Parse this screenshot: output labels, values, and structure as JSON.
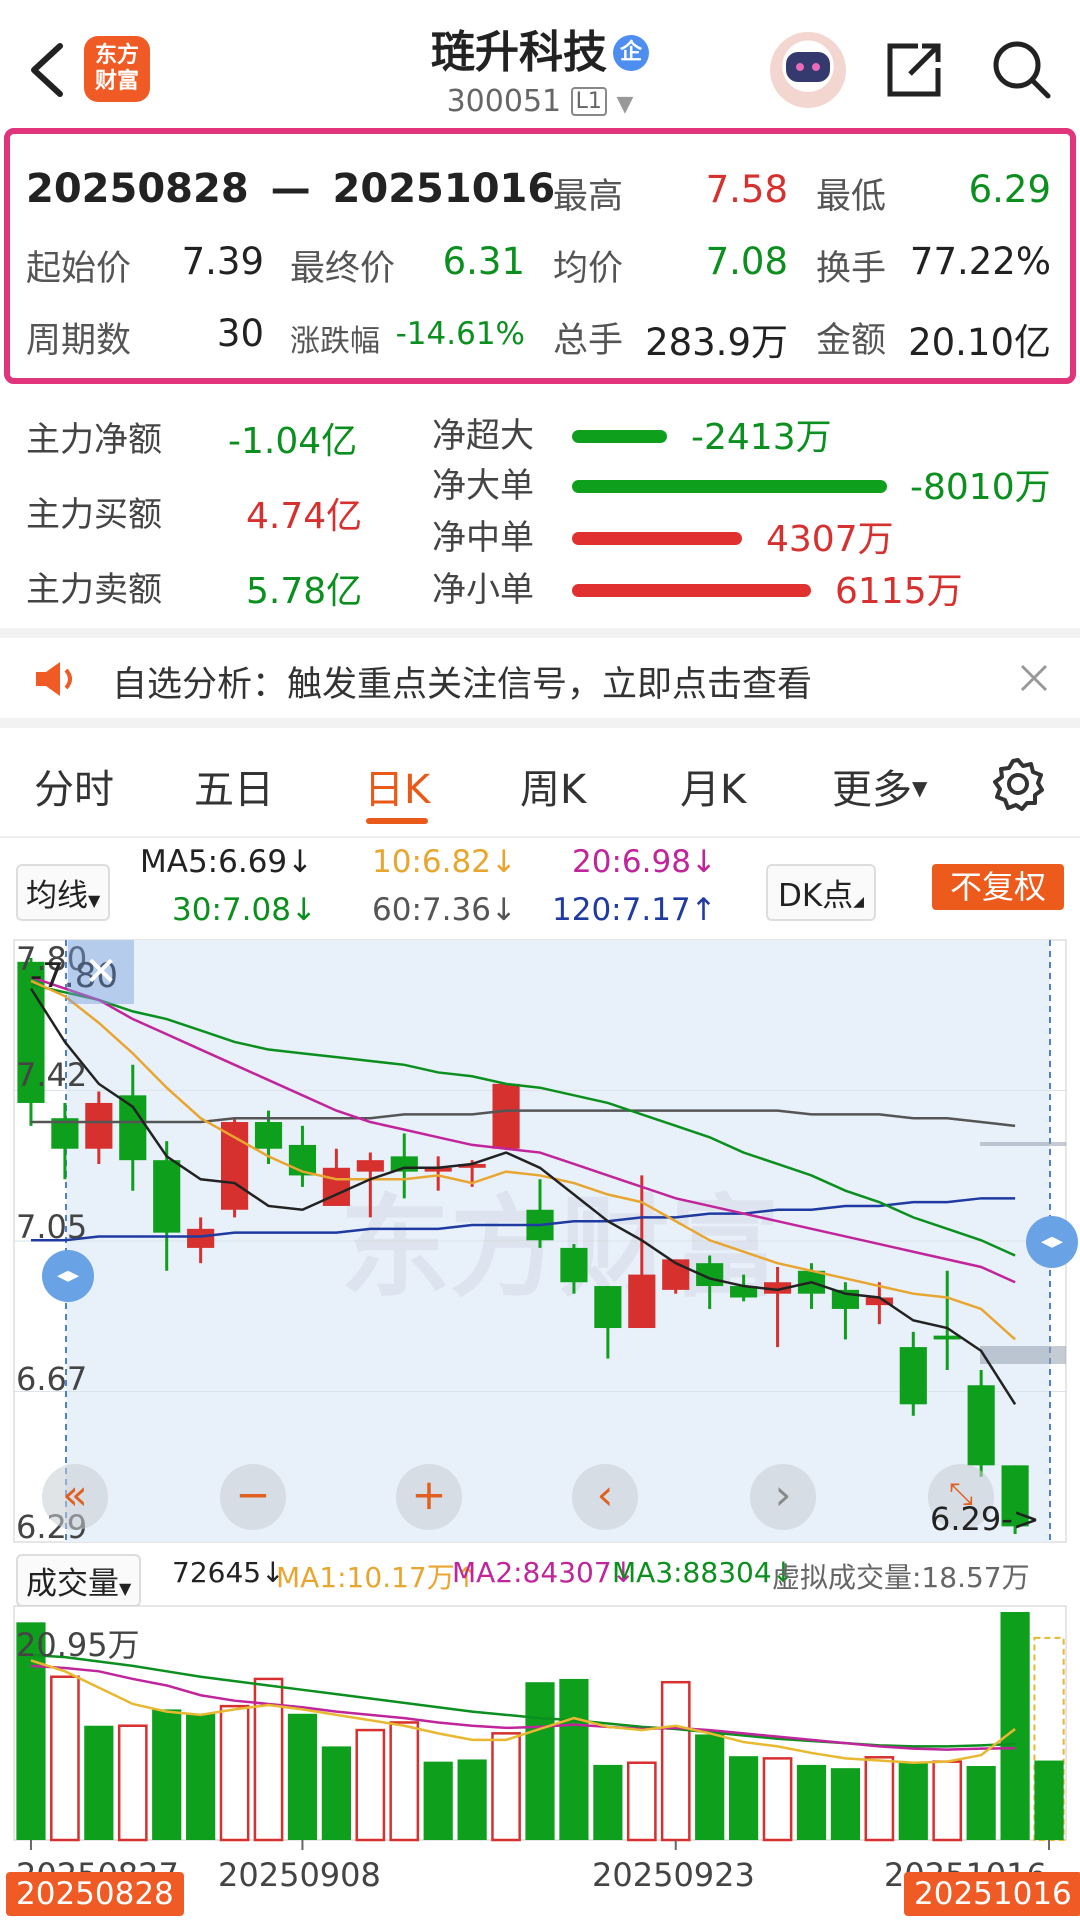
{
  "header": {
    "title": "琏升科技",
    "badge": "企",
    "code": "300051",
    "level": "L1",
    "logo_line1": "东方",
    "logo_line2": "财富"
  },
  "summary": {
    "range_start": "20250828",
    "range_sep": "—",
    "range_end": "20251016",
    "high_label": "最高",
    "high": "7.58",
    "low_label": "最低",
    "low": "6.29",
    "open_label": "起始价",
    "open": "7.39",
    "close_label": "最终价",
    "close": "6.31",
    "avg_label": "均价",
    "avg": "7.08",
    "turnover_label": "换手",
    "turnover": "77.22%",
    "periods_label": "周期数",
    "periods": "30",
    "change_label": "涨跌幅",
    "change": "-14.61%",
    "volume_label": "总手",
    "volume": "283.9万",
    "amount_label": "金额",
    "amount": "20.10亿"
  },
  "flow": {
    "net_label": "主力净额",
    "net": "-1.04亿",
    "buy_label": "主力买额",
    "buy": "4.74亿",
    "sell_label": "主力卖额",
    "sell": "5.78亿",
    "rows": [
      {
        "label": "净超大",
        "value": "-2413万",
        "color": "#0e9f1d",
        "fraction": 0.3
      },
      {
        "label": "净大单",
        "value": "-8010万",
        "color": "#0e9f1d",
        "fraction": 1.0
      },
      {
        "label": "净中单",
        "value": "4307万",
        "color": "#e03030",
        "fraction": 0.54
      },
      {
        "label": "净小单",
        "value": "6115万",
        "color": "#e03030",
        "fraction": 0.76
      }
    ]
  },
  "banner": {
    "text": "自选分析：触发重点关注信号，立即点击查看"
  },
  "tabs": [
    "分时",
    "五日",
    "日K",
    "周K",
    "月K",
    "更多"
  ],
  "active_tab": "日K",
  "ma": {
    "selector": "均线",
    "ma5": "MA5:6.69↓",
    "ma10": "10:6.82↓",
    "ma20": "20:6.98↓",
    "ma30": "30:7.08↓",
    "ma60": "60:7.36↓",
    "ma120": "120:7.17↑",
    "dk": "DK点",
    "fq": "不复权",
    "colors": {
      "ma5": "#222222",
      "ma10": "#e8a630",
      "ma20": "#c0259b",
      "ma30": "#0b8f1e",
      "ma60": "#555555",
      "ma120": "#1f3aa0"
    }
  },
  "kline": {
    "y_labels": [
      "7.80",
      "7.42",
      "7.05",
      "6.67",
      "6.29"
    ],
    "cursor_label": "7.80",
    "low_marker": "6.29->",
    "watermark": "东方财富"
  },
  "volume": {
    "selector": "成交量",
    "v": "72645↓",
    "ma1": "MA1:10.17万↑",
    "ma2": "MA2:84307↓",
    "ma3": "MA3:88304↓",
    "virtual": "虚拟成交量:18.57万",
    "max_label": "20.95万"
  },
  "x_axis": {
    "labels": [
      "20250827",
      "20250908",
      "20250923",
      "20251016"
    ],
    "start_badge": "20250828",
    "end_badge": "20251016"
  },
  "chart_data": {
    "type": "candlestick",
    "ylim": [
      6.29,
      7.8
    ],
    "candles": [
      {
        "o": 7.79,
        "c": 7.42,
        "h": 7.8,
        "l": 7.36
      },
      {
        "o": 7.38,
        "c": 7.3,
        "h": 7.42,
        "l": 7.22
      },
      {
        "o": 7.3,
        "c": 7.42,
        "h": 7.45,
        "l": 7.26
      },
      {
        "o": 7.44,
        "c": 7.27,
        "h": 7.52,
        "l": 7.19
      },
      {
        "o": 7.27,
        "c": 7.08,
        "h": 7.32,
        "l": 6.98
      },
      {
        "o": 7.04,
        "c": 7.09,
        "h": 7.12,
        "l": 7.0
      },
      {
        "o": 7.14,
        "c": 7.37,
        "h": 7.38,
        "l": 7.12
      },
      {
        "o": 7.37,
        "c": 7.3,
        "h": 7.4,
        "l": 7.26
      },
      {
        "o": 7.31,
        "c": 7.23,
        "h": 7.36,
        "l": 7.2
      },
      {
        "o": 7.15,
        "c": 7.25,
        "h": 7.3,
        "l": 7.15
      },
      {
        "o": 7.24,
        "c": 7.27,
        "h": 7.29,
        "l": 7.12
      },
      {
        "o": 7.28,
        "c": 7.24,
        "h": 7.34,
        "l": 7.17
      },
      {
        "o": 7.24,
        "c": 7.25,
        "h": 7.28,
        "l": 7.19
      },
      {
        "o": 7.25,
        "c": 7.26,
        "h": 7.27,
        "l": 7.2
      },
      {
        "o": 7.3,
        "c": 7.47,
        "h": 7.47,
        "l": 7.3
      },
      {
        "o": 7.14,
        "c": 7.06,
        "h": 7.22,
        "l": 7.04
      },
      {
        "o": 7.04,
        "c": 6.95,
        "h": 7.05,
        "l": 6.92
      },
      {
        "o": 6.94,
        "c": 6.83,
        "h": 6.94,
        "l": 6.75
      },
      {
        "o": 6.83,
        "c": 6.97,
        "h": 7.23,
        "l": 6.83
      },
      {
        "o": 6.93,
        "c": 7.01,
        "h": 7.01,
        "l": 6.92
      },
      {
        "o": 7.0,
        "c": 6.94,
        "h": 7.02,
        "l": 6.88
      },
      {
        "o": 6.94,
        "c": 6.91,
        "h": 6.97,
        "l": 6.9
      },
      {
        "o": 6.92,
        "c": 6.95,
        "h": 6.99,
        "l": 6.78
      },
      {
        "o": 6.98,
        "c": 6.92,
        "h": 7.0,
        "l": 6.88
      },
      {
        "o": 6.93,
        "c": 6.88,
        "h": 6.95,
        "l": 6.8
      },
      {
        "o": 6.89,
        "c": 6.91,
        "h": 6.95,
        "l": 6.84
      },
      {
        "o": 6.78,
        "c": 6.63,
        "h": 6.82,
        "l": 6.6
      },
      {
        "o": 6.81,
        "c": 6.8,
        "h": 6.98,
        "l": 6.72
      },
      {
        "o": 6.68,
        "c": 6.47,
        "h": 6.72,
        "l": 6.44
      },
      {
        "o": 6.47,
        "c": 6.31,
        "h": 6.47,
        "l": 6.29
      }
    ],
    "ma5": [
      7.72,
      7.58,
      7.47,
      7.41,
      7.28,
      7.22,
      7.21,
      7.15,
      7.14,
      7.18,
      7.22,
      7.25,
      7.25,
      7.26,
      7.29,
      7.25,
      7.18,
      7.11,
      7.06,
      7.0,
      6.96,
      6.94,
      6.93,
      6.95,
      6.92,
      6.91,
      6.85,
      6.83,
      6.77,
      6.63
    ],
    "ma10": [
      7.74,
      7.7,
      7.63,
      7.55,
      7.46,
      7.38,
      7.33,
      7.28,
      7.24,
      7.22,
      7.22,
      7.22,
      7.23,
      7.21,
      7.24,
      7.23,
      7.21,
      7.18,
      7.16,
      7.11,
      7.06,
      7.03,
      7.0,
      6.98,
      6.96,
      6.94,
      6.92,
      6.91,
      6.88,
      6.8
    ],
    "ma20": [
      7.75,
      7.72,
      7.69,
      7.64,
      7.6,
      7.56,
      7.52,
      7.48,
      7.44,
      7.4,
      7.37,
      7.35,
      7.33,
      7.31,
      7.3,
      7.29,
      7.26,
      7.23,
      7.2,
      7.17,
      7.15,
      7.13,
      7.11,
      7.09,
      7.07,
      7.05,
      7.03,
      7.01,
      6.99,
      6.95
    ],
    "ma30": [
      7.73,
      7.71,
      7.69,
      7.66,
      7.64,
      7.61,
      7.58,
      7.56,
      7.55,
      7.54,
      7.53,
      7.52,
      7.5,
      7.49,
      7.47,
      7.46,
      7.44,
      7.42,
      7.39,
      7.36,
      7.33,
      7.29,
      7.26,
      7.23,
      7.19,
      7.16,
      7.12,
      7.09,
      7.06,
      7.02
    ],
    "ma60": [
      7.37,
      7.37,
      7.37,
      7.37,
      7.37,
      7.37,
      7.38,
      7.38,
      7.38,
      7.38,
      7.38,
      7.39,
      7.39,
      7.39,
      7.4,
      7.4,
      7.4,
      7.4,
      7.4,
      7.4,
      7.4,
      7.4,
      7.4,
      7.39,
      7.39,
      7.39,
      7.38,
      7.38,
      7.37,
      7.36
    ],
    "ma120": [
      7.06,
      7.06,
      7.07,
      7.07,
      7.07,
      7.07,
      7.08,
      7.08,
      7.08,
      7.08,
      7.09,
      7.09,
      7.09,
      7.1,
      7.1,
      7.1,
      7.11,
      7.11,
      7.12,
      7.12,
      7.13,
      7.13,
      7.14,
      7.14,
      7.15,
      7.15,
      7.16,
      7.16,
      7.17,
      7.17
    ],
    "volumes": [
      20.0,
      15.0,
      10.5,
      10.5,
      12.0,
      11.6,
      12.3,
      14.8,
      11.6,
      8.6,
      10.1,
      10.8,
      7.2,
      7.4,
      9.8,
      14.5,
      14.8,
      6.9,
      7.1,
      14.5,
      9.7,
      7.7,
      7.5,
      6.9,
      6.6,
      7.6,
      7.1,
      7.2,
      6.8,
      20.95,
      7.3
    ],
    "volume_up": [
      false,
      true,
      false,
      true,
      false,
      false,
      true,
      true,
      false,
      false,
      true,
      true,
      false,
      false,
      true,
      false,
      false,
      false,
      true,
      true,
      false,
      false,
      true,
      false,
      false,
      true,
      false,
      true,
      false,
      false
    ],
    "vol_ma1": [
      16.5,
      15.5,
      14.0,
      12.5,
      11.8,
      11.5,
      12.0,
      12.4,
      12.0,
      11.5,
      11.0,
      10.5,
      9.8,
      9.2,
      9.2,
      10.2,
      11.2,
      10.4,
      10.1,
      10.5,
      9.8,
      9.0,
      8.6,
      8.0,
      7.5,
      7.3,
      7.1,
      7.2,
      7.8,
      10.2
    ],
    "vol_ma2": [
      16.0,
      15.8,
      15.5,
      14.8,
      14.2,
      13.3,
      12.8,
      12.5,
      12.2,
      11.8,
      11.5,
      11.2,
      10.8,
      10.5,
      10.3,
      10.4,
      10.6,
      10.4,
      10.2,
      10.3,
      10.1,
      9.8,
      9.5,
      9.2,
      8.9,
      8.6,
      8.4,
      8.3,
      8.4,
      8.43
    ],
    "vol_ma3": [
      17.0,
      16.8,
      16.4,
      16.0,
      15.5,
      15.0,
      14.6,
      14.2,
      13.8,
      13.4,
      13.0,
      12.6,
      12.2,
      11.8,
      11.5,
      11.2,
      11.0,
      10.7,
      10.4,
      10.2,
      9.9,
      9.6,
      9.3,
      9.1,
      8.9,
      8.7,
      8.6,
      8.6,
      8.7,
      8.83
    ]
  }
}
